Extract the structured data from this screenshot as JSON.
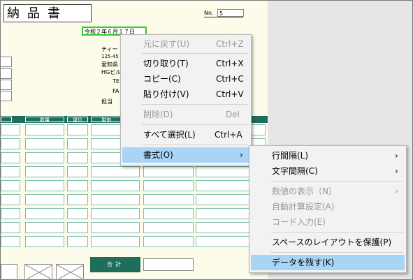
{
  "document": {
    "title": "納品書",
    "no_label": "No.",
    "no_value": "5",
    "date": "令和２年６月１７日",
    "sender": {
      "line1": "ティー",
      "line2": "125-45",
      "line3": "愛知県",
      "line4": "HGビル",
      "line5": "TE",
      "line6": "FA",
      "line7": "担当"
    },
    "table_headers": [
      "",
      "数量",
      "単位",
      "単価"
    ],
    "sum_label": "合計"
  },
  "context_menu": {
    "items": [
      {
        "label": "元に戻す(U)",
        "shortcut": "Ctrl+Z",
        "disabled": true
      },
      {
        "label": "切り取り(T)",
        "shortcut": "Ctrl+X",
        "disabled": false
      },
      {
        "label": "コピー(C)",
        "shortcut": "Ctrl+C",
        "disabled": false
      },
      {
        "label": "貼り付け(V)",
        "shortcut": "Ctrl+V",
        "disabled": false
      },
      {
        "label": "削除(D)",
        "shortcut": "Del",
        "disabled": true
      },
      {
        "label": "すべて選択(L)",
        "shortcut": "Ctrl+A",
        "disabled": false
      },
      {
        "label": "書式(O)",
        "shortcut": "",
        "disabled": false
      }
    ]
  },
  "submenu": {
    "items": [
      {
        "label": "行間隔(L)",
        "disabled": false
      },
      {
        "label": "文字間隔(C)",
        "disabled": false
      },
      {
        "label": "数値の表示（N）",
        "disabled": true
      },
      {
        "label": "自動計算設定(A)",
        "disabled": true
      },
      {
        "label": "コード入力(E)",
        "disabled": true
      },
      {
        "label": "スペースのレイアウトを保護(P)",
        "disabled": false
      },
      {
        "label": "データを残す(K)",
        "disabled": false
      }
    ]
  },
  "colors": {
    "highlight": "#a8d4f6",
    "table_header": "#1f6e5b",
    "date_border": "#2bcd2b"
  }
}
